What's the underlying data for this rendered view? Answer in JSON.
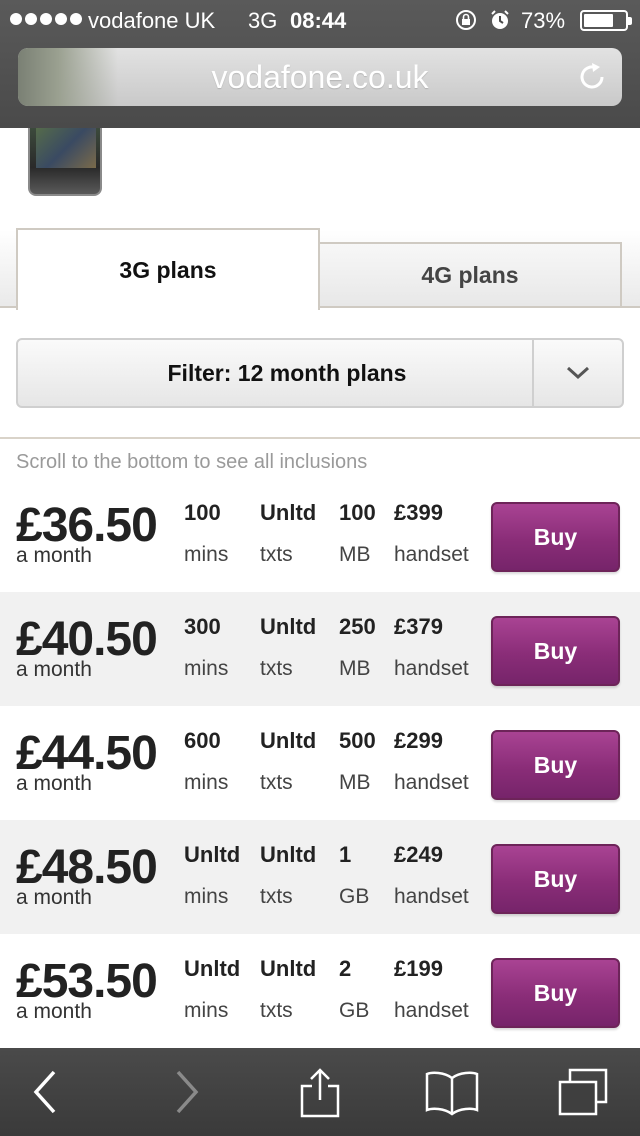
{
  "status_bar": {
    "carrier": "vodafone UK",
    "network": "3G",
    "time": "08:44",
    "battery": "73%"
  },
  "browser": {
    "url": "vodafone.co.uk"
  },
  "tabs": [
    {
      "label": "3G plans",
      "active": true
    },
    {
      "label": "4G plans",
      "active": false
    }
  ],
  "filter": {
    "label": "Filter: 12 month plans"
  },
  "scroll_hint": "Scroll to the bottom to see all inclusions",
  "plans": [
    {
      "price": "£36.50",
      "period": "a month",
      "mins": "100",
      "mins_unit": "mins",
      "txts": "Unltd",
      "txts_unit": "txts",
      "data": "100",
      "data_unit": "MB",
      "handset": "£399",
      "handset_unit": "handset",
      "buy": "Buy"
    },
    {
      "price": "£40.50",
      "period": "a month",
      "mins": "300",
      "mins_unit": "mins",
      "txts": "Unltd",
      "txts_unit": "txts",
      "data": "250",
      "data_unit": "MB",
      "handset": "£379",
      "handset_unit": "handset",
      "buy": "Buy"
    },
    {
      "price": "£44.50",
      "period": "a month",
      "mins": "600",
      "mins_unit": "mins",
      "txts": "Unltd",
      "txts_unit": "txts",
      "data": "500",
      "data_unit": "MB",
      "handset": "£299",
      "handset_unit": "handset",
      "buy": "Buy"
    },
    {
      "price": "£48.50",
      "period": "a month",
      "mins": "Unltd",
      "mins_unit": "mins",
      "txts": "Unltd",
      "txts_unit": "txts",
      "data": "1",
      "data_unit": "GB",
      "handset": "£249",
      "handset_unit": "handset",
      "buy": "Buy"
    },
    {
      "price": "£53.50",
      "period": "a month",
      "mins": "Unltd",
      "mins_unit": "mins",
      "txts": "Unltd",
      "txts_unit": "txts",
      "data": "2",
      "data_unit": "GB",
      "handset": "£199",
      "handset_unit": "handset",
      "buy": "Buy"
    }
  ],
  "colors": {
    "buy_button": "#8a2d78",
    "chrome": "#4a4a4a"
  },
  "icons": [
    "signal-icon",
    "lock-rotation-icon",
    "alarm-icon",
    "battery-icon",
    "reload-icon",
    "chevron-down-icon",
    "back-icon",
    "forward-icon",
    "share-icon",
    "bookmarks-icon",
    "tabs-icon"
  ]
}
